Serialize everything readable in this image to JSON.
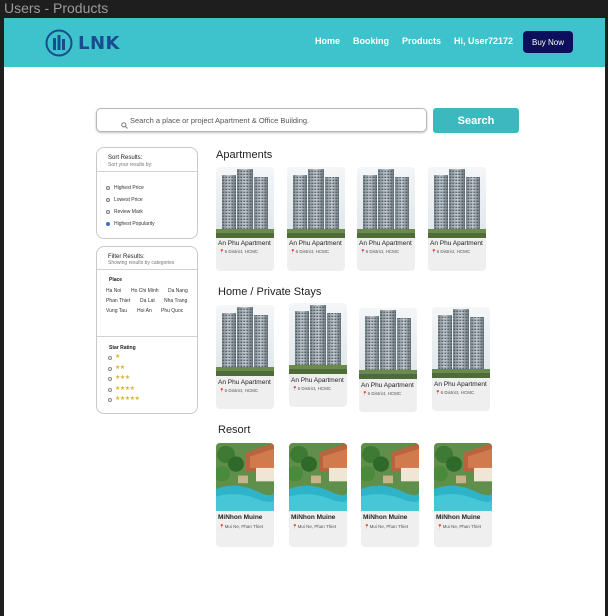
{
  "frame": {
    "title": "Users - Products"
  },
  "nav": {
    "logo_text": "LNK",
    "links": [
      "Home",
      "Booking",
      "Products",
      "Hi, User72172"
    ],
    "buy_label": "Buy Now"
  },
  "search": {
    "placeholder": "Search a place or project Apartment & Office Building.",
    "button_label": "Search"
  },
  "sort": {
    "title": "Sort Results:",
    "subtitle": "Sort your results by:",
    "options": [
      "Highest Price",
      "Lowest Price",
      "Review Mark",
      "Highest Popularity"
    ],
    "selected": "Highest Popularity"
  },
  "filter": {
    "title": "Filter Results:",
    "subtitle": "Showing results by categories",
    "place_heading": "Place",
    "places": [
      "Ha Noi",
      "Ho Chi Minh",
      "Da Nang",
      "Phan Thiet",
      "Da Lat",
      "Nha Trang",
      "Vung Tau",
      "Hoi An",
      "Phu Quoc"
    ],
    "star_heading": "Star Rating",
    "star_options": [
      "★",
      "★★",
      "★★★",
      "★★★★",
      "★★★★★"
    ]
  },
  "sections": {
    "apartments": {
      "title": "Apartments",
      "cards": [
        {
          "name": "An Phu Apartment",
          "location": "6 District, HCMC"
        },
        {
          "name": "An Phu Apartment",
          "location": "6 District, HCMC"
        },
        {
          "name": "An Phu Apartment",
          "location": "6 District, HCMC"
        },
        {
          "name": "An Phu Apartment",
          "location": "6 District, HCMC"
        }
      ]
    },
    "homestays": {
      "title": "Home / Private Stays",
      "cards": [
        {
          "name": "An Phu Apartment",
          "location": "6 District, HCMC"
        },
        {
          "name": "An Phu Apartment",
          "location": "6 District, HCMC"
        },
        {
          "name": "An Phu Apartment",
          "location": "6 District, HCMC"
        },
        {
          "name": "An Phu Apartment",
          "location": "6 District, HCMC"
        }
      ]
    },
    "resort": {
      "title": "Resort",
      "cards": [
        {
          "name": "MiNhon Muine",
          "location": "Mui Ne, Phan Thiet"
        },
        {
          "name": "MiNhon Muine",
          "location": "Mui Ne, Phan Thiet"
        },
        {
          "name": "MiNhon Muine",
          "location": "Mui Ne, Phan Thiet"
        },
        {
          "name": "MiNhon Muine",
          "location": "Mui Ne, Phan Thiet"
        }
      ]
    }
  },
  "colors": {
    "navbar": "#3ec3cc",
    "buy_button": "#0b0f5c",
    "search_button": "#3eb8bf",
    "logo": "#1b4b8f",
    "selected_radio": "#3b6fd6",
    "star": "#e0b12a"
  }
}
